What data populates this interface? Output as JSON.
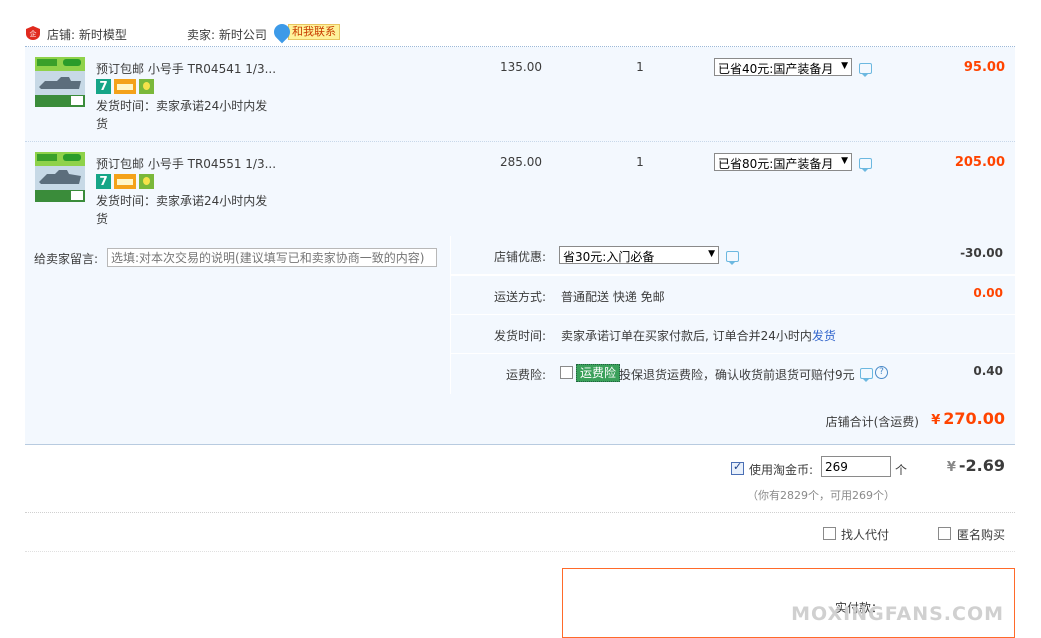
{
  "store": {
    "store_label": "店铺: 新时模型",
    "seller_label": "卖家: 新时公司",
    "contact_label": "和我联系"
  },
  "items": [
    {
      "title": "预订包邮 小号手 TR04541 1/3...",
      "ship_time": "发货时间：卖家承诺24小时内发货",
      "badge_seven": "7",
      "price": "135.00",
      "qty": "1",
      "discount": "已省40元:国产装备月",
      "subtotal": "95.00"
    },
    {
      "title": "预订包邮 小号手 TR04551 1/3...",
      "ship_time": "发货时间：卖家承诺24小时内发货",
      "badge_seven": "7",
      "price": "285.00",
      "qty": "1",
      "discount": "已省80元:国产装备月",
      "subtotal": "205.00"
    }
  ],
  "message": {
    "label": "给卖家留言:",
    "placeholder": "选填:对本次交易的说明(建议填写已和卖家协商一致的内容)"
  },
  "summary": {
    "coupon_label": "店铺优惠:",
    "coupon_value": "省30元:入门必备",
    "coupon_amount": "-30.00",
    "shipping_label": "运送方式:",
    "shipping_value": "普通配送 快递 免邮",
    "shipping_amount": "0.00",
    "delivery_label": "发货时间:",
    "delivery_value": "卖家承诺订单在买家付款后, 订单合并24小时内",
    "delivery_link": "发货",
    "insurance_label": "运费险:",
    "insurance_tag": "运费险",
    "insurance_text": "投保退货运费险，确认收货前退货可赔付9元",
    "insurance_amount": "0.40"
  },
  "total": {
    "label": "店铺合计(含运费)",
    "currency": "¥",
    "value": "270.00"
  },
  "coins": {
    "label": "使用淘金币:",
    "value": "269",
    "unit": "个",
    "currency": "¥",
    "amount": "-2.69",
    "note": "（你有2829个，可用269个）"
  },
  "options": {
    "proxy_label": "找人代付",
    "anonymous_label": "匿名购买"
  },
  "pay": {
    "label": "实付款：",
    "watermark": "MOXINGFANS.COM"
  },
  "colors": {
    "accent": "#ff4400",
    "row_bg": "#f3f8fe",
    "link": "#3366cc"
  }
}
